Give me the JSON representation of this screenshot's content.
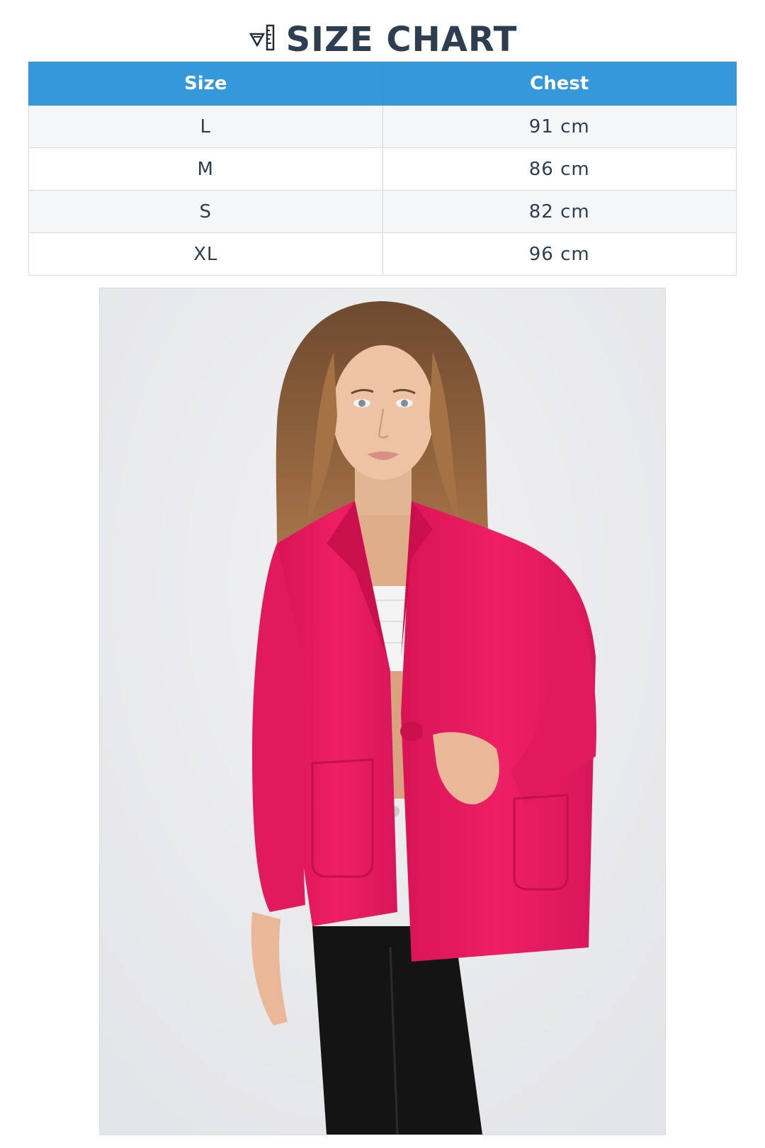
{
  "header": {
    "title": "SIZE CHART",
    "icon": "ruler-pencil-icon"
  },
  "table": {
    "columns": [
      "Size",
      "Chest"
    ],
    "rows": [
      {
        "size": "L",
        "chest": "91 cm"
      },
      {
        "size": "M",
        "chest": "86 cm"
      },
      {
        "size": "S",
        "chest": "82 cm"
      },
      {
        "size": "XL",
        "chest": "96 cm"
      }
    ]
  },
  "photo": {
    "subject": "product-photo",
    "colors": {
      "jacket": "#e8195e",
      "background": "#ebebee",
      "hair": "#8a5a36",
      "top": "#f4f4f4",
      "pants": "#141414"
    }
  },
  "colors": {
    "header_bg": "#3498db",
    "title_text": "#2c3e50",
    "row_alt": "#f4f6f8"
  }
}
